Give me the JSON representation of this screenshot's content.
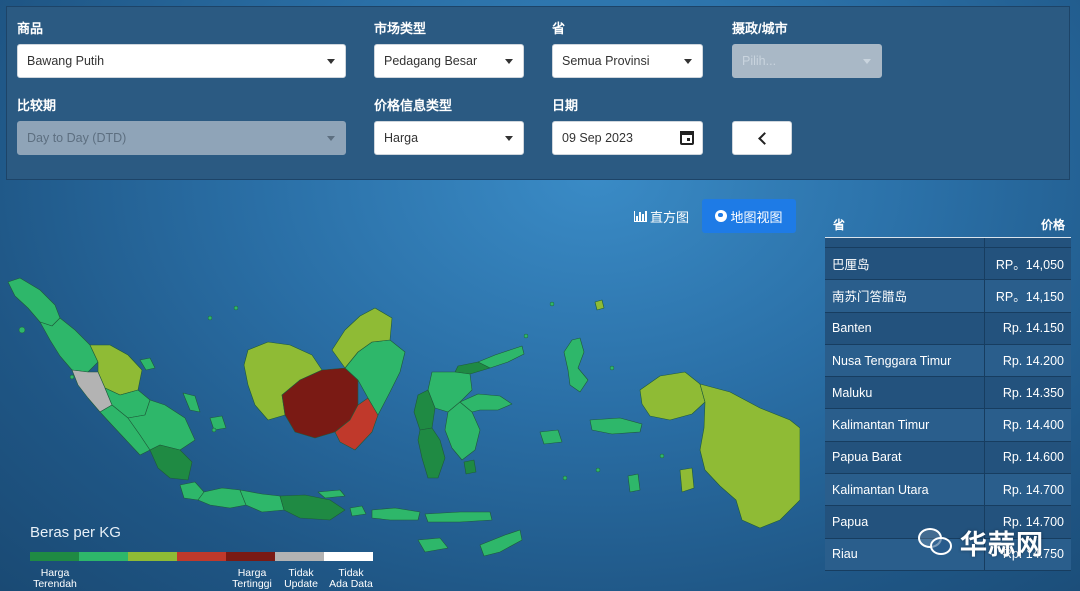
{
  "filters": {
    "commodity_label": "商品",
    "commodity_value": "Bawang Putih",
    "market_type_label": "市场类型",
    "market_type_value": "Pedagang Besar",
    "province_label": "省",
    "province_value": "Semua Provinsi",
    "regency_label": "摄政/城市",
    "regency_placeholder": "Pilih...",
    "comparison_label": "比较期",
    "comparison_value": "Day to Day (DTD)",
    "price_info_label": "价格信息类型",
    "price_info_value": "Harga",
    "date_label": "日期",
    "date_value": "09 Sep 2023"
  },
  "views": {
    "histogram_label": "直方图",
    "map_label": "地图视图"
  },
  "legend": {
    "title": "Beras per KG",
    "colors": [
      "#1f8a43",
      "#2eb76a",
      "#8fbb35",
      "#c0392b",
      "#7a1a14",
      "#b3b3b3",
      "#ffffff"
    ],
    "labels": {
      "lowest_line1": "Harga",
      "lowest_line2": "Terendah",
      "highest_line1": "Harga",
      "highest_line2": "Tertinggi",
      "no_update_line1": "Tidak",
      "no_update_line2": "Update",
      "no_data_line1": "Tidak",
      "no_data_line2": "Ada Data"
    }
  },
  "table": {
    "col_province": "省",
    "col_price": "价格",
    "rows": [
      {
        "province": "巴厘岛",
        "price": "RP。14,050"
      },
      {
        "province": "南苏门答腊岛",
        "price": "RP。14,150"
      },
      {
        "province": "Banten",
        "price": "Rp. 14.150"
      },
      {
        "province": "Nusa Tenggara Timur",
        "price": "Rp. 14.200"
      },
      {
        "province": "Maluku",
        "price": "Rp. 14.350"
      },
      {
        "province": "Kalimantan Timur",
        "price": "Rp. 14.400"
      },
      {
        "province": "Papua Barat",
        "price": "Rp. 14.600"
      },
      {
        "province": "Kalimantan Utara",
        "price": "Rp. 14.700"
      },
      {
        "province": "Papua",
        "price": "Rp. 14.700"
      },
      {
        "province": "Riau",
        "price": "Rp. 14.750"
      }
    ]
  },
  "watermark": "华蒜网",
  "map_colors": {
    "dark_green": "#1f8a43",
    "green": "#2eb76a",
    "olive": "#8fbb35",
    "red": "#c0392b",
    "dark_red": "#7a1a14",
    "gray": "#b3b3b3"
  }
}
